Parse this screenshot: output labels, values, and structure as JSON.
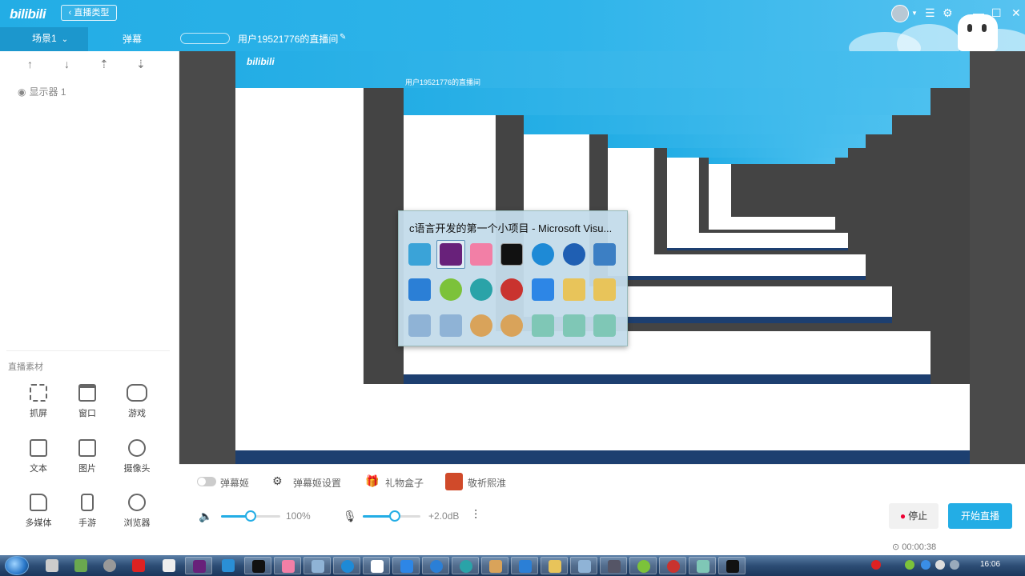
{
  "header": {
    "logo": "bilibili",
    "back_label": "直播类型",
    "scene_tab": "场景1",
    "danmu_tab": "弹幕",
    "room_title": "用户19521776的直播间"
  },
  "sources": {
    "display_item": "显示器 1"
  },
  "materials": {
    "title": "直播素材",
    "items": [
      "抓屏",
      "窗口",
      "游戏",
      "文本",
      "图片",
      "摄像头",
      "多媒体",
      "手游",
      "浏览器"
    ]
  },
  "switcher": {
    "title": "c语言开发的第一个小项目 - Microsoft Visu..."
  },
  "controls": {
    "danmu_ji": "弹幕姬",
    "danmu_settings": "弹幕姬设置",
    "gift_box": "礼物盒子",
    "pray": "敬祈熙淮",
    "volume_percent": "100%",
    "volume_level": 0.5,
    "mic_gain": "+2.0dB",
    "mic_level": 0.55,
    "stop_label": "停止",
    "start_label": "开始直播",
    "timer": "00:00:38"
  },
  "taskbar": {
    "clock": "16:06"
  },
  "colors": {
    "accent": "#23ade5",
    "taskbar": "#2d4d75"
  }
}
